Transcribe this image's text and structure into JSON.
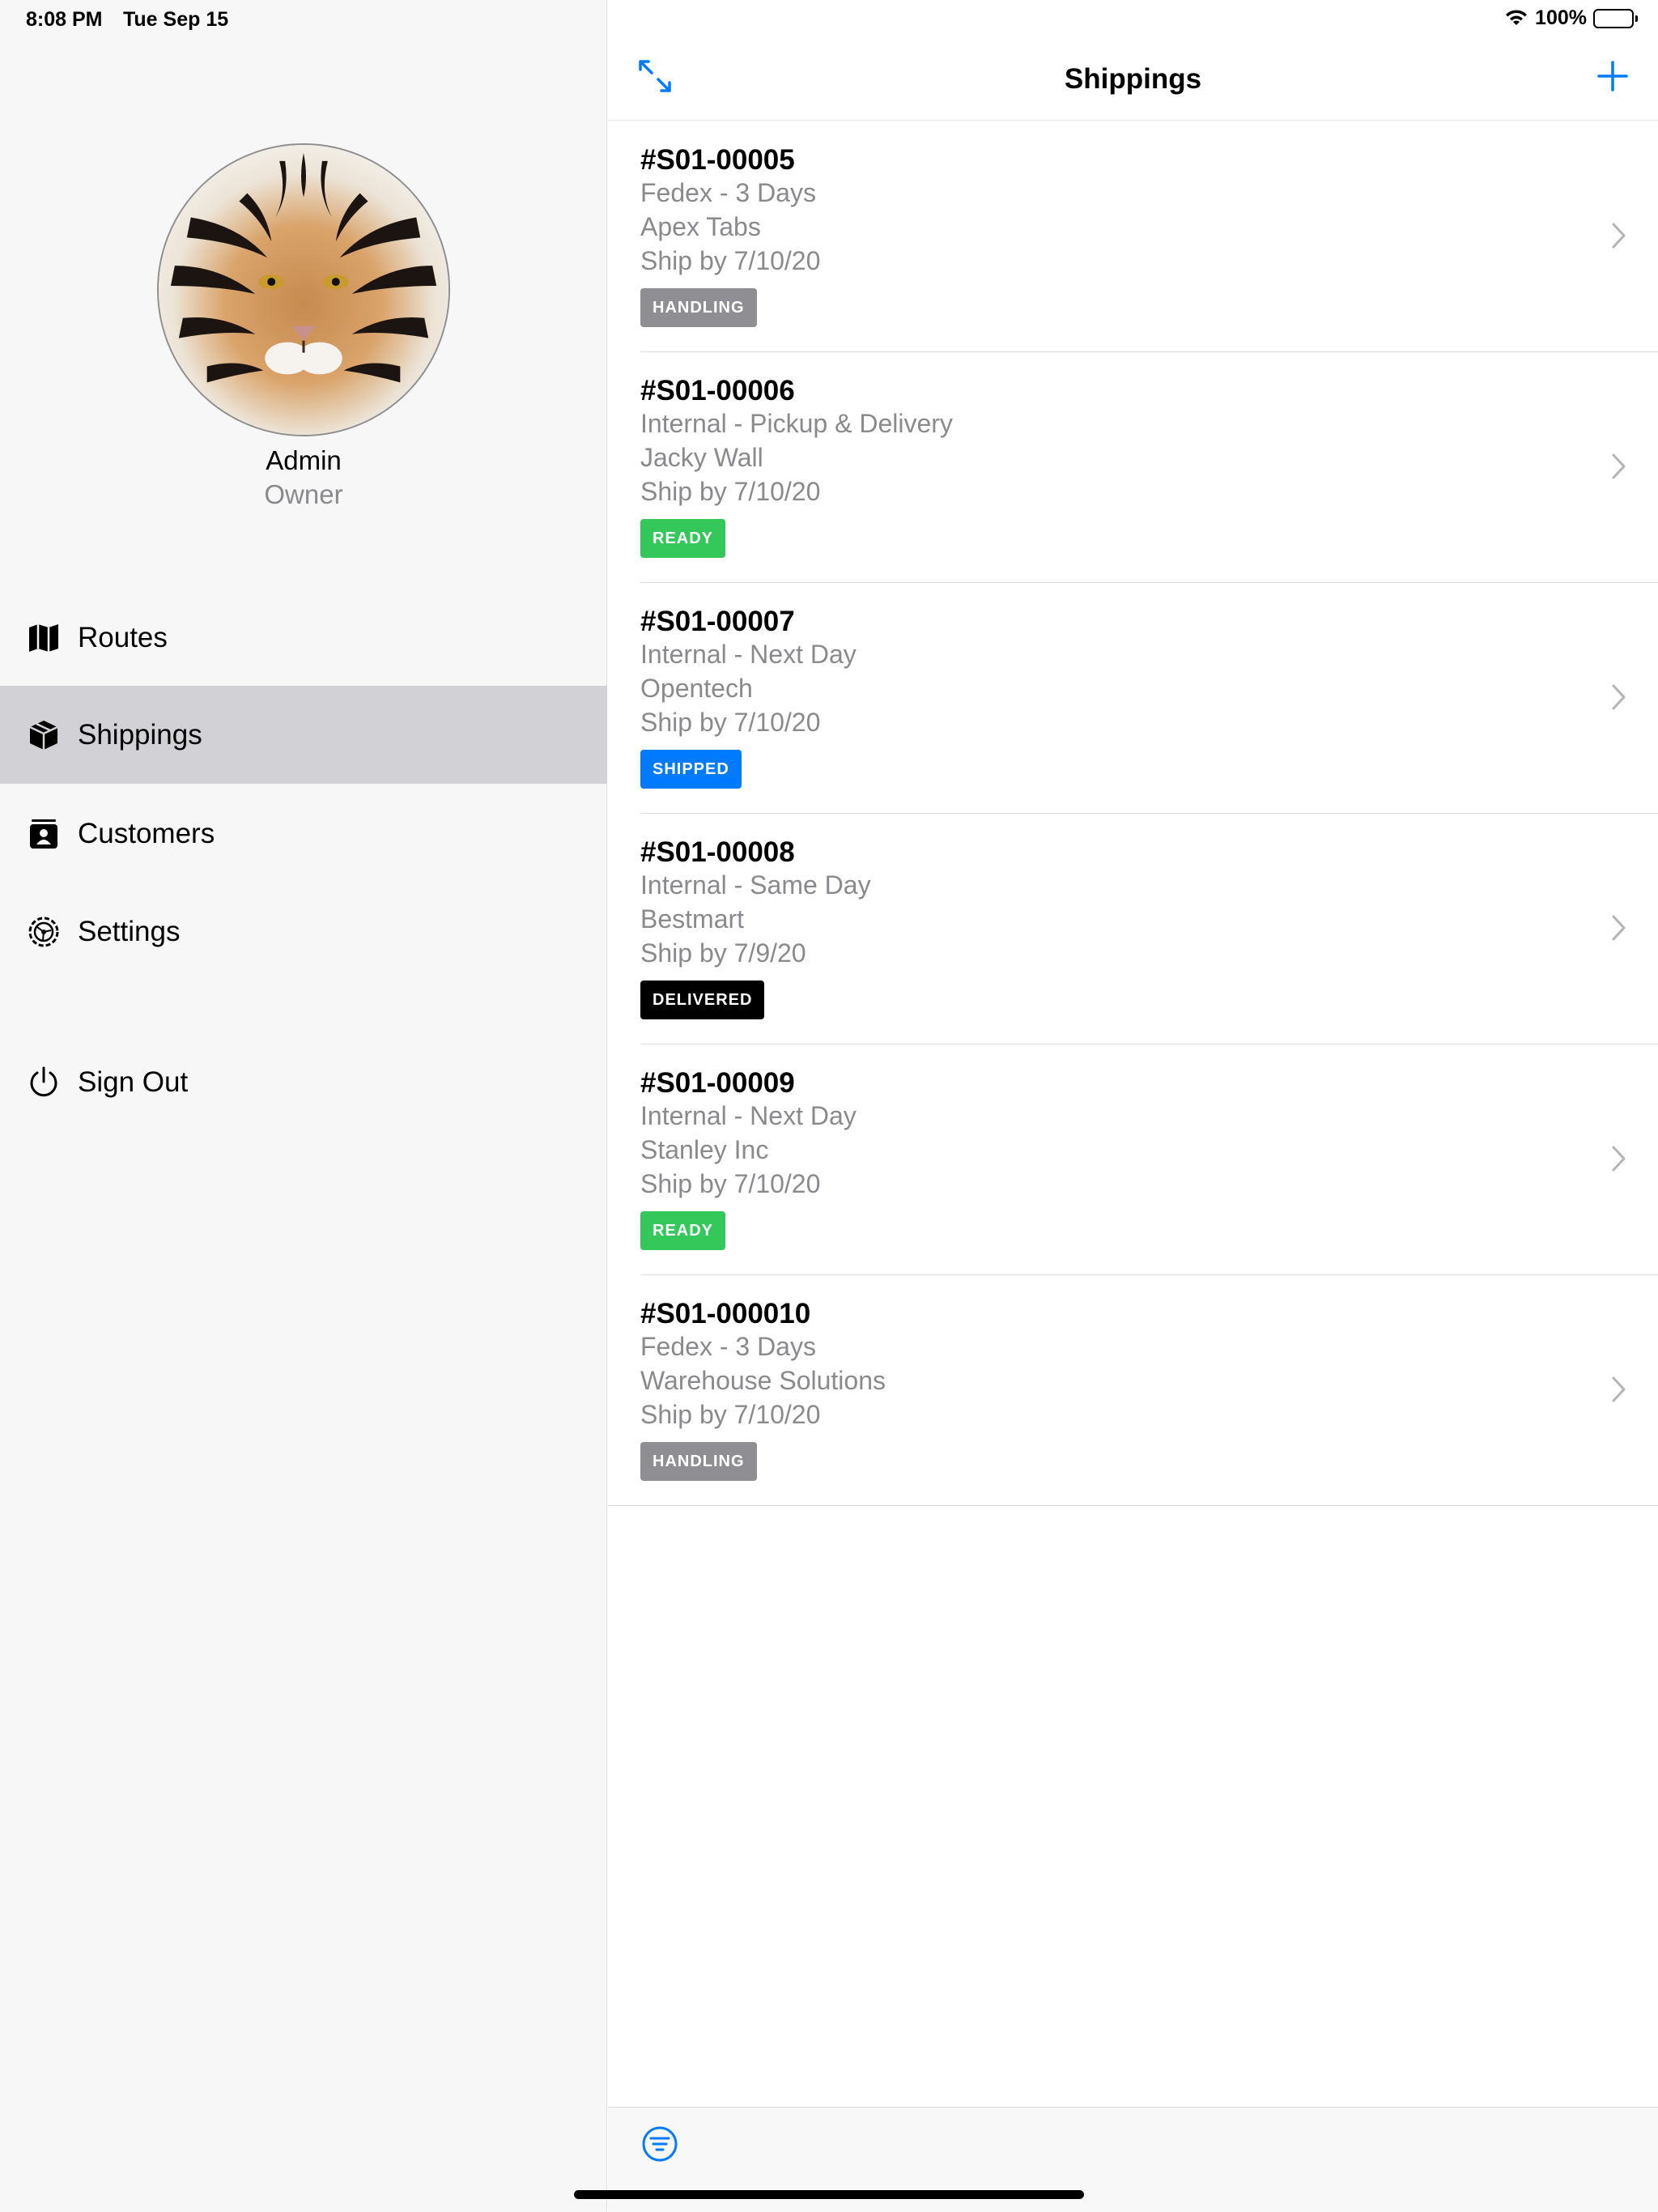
{
  "status_bar": {
    "time": "8:08 PM",
    "date": "Tue Sep 15",
    "battery": "100%",
    "icons": [
      "wifi-icon",
      "battery-icon"
    ]
  },
  "sidebar": {
    "profile": {
      "name": "Admin",
      "role": "Owner"
    },
    "items": [
      {
        "label": "Routes",
        "icon": "map-icon",
        "active": false
      },
      {
        "label": "Shippings",
        "icon": "box-icon",
        "active": true
      },
      {
        "label": "Customers",
        "icon": "contact-book-icon",
        "active": false
      },
      {
        "label": "Settings",
        "icon": "gear-icon",
        "active": false
      }
    ],
    "sign_out": {
      "label": "Sign Out",
      "icon": "power-icon"
    }
  },
  "navbar": {
    "title": "Shippings",
    "left_icon": "expand-icon",
    "right_icon": "plus-icon"
  },
  "colors": {
    "accent": "#007aff",
    "handling": "#8e8e93",
    "ready": "#34c759",
    "shipped": "#007aff",
    "delivered": "#000000",
    "sidebar_active": "#d1d1d6"
  },
  "shipments": [
    {
      "id": "#S01-00005",
      "service": "Fedex - 3 Days",
      "customer": "Apex Tabs",
      "ship_by": "Ship by 7/10/20",
      "status": "HANDLING",
      "status_color": "#8e8e93"
    },
    {
      "id": "#S01-00006",
      "service": "Internal - Pickup & Delivery",
      "customer": "Jacky Wall",
      "ship_by": "Ship by 7/10/20",
      "status": "READY",
      "status_color": "#34c759"
    },
    {
      "id": "#S01-00007",
      "service": "Internal - Next Day",
      "customer": "Opentech",
      "ship_by": "Ship by 7/10/20",
      "status": "SHIPPED",
      "status_color": "#007aff"
    },
    {
      "id": "#S01-00008",
      "service": "Internal - Same Day",
      "customer": "Bestmart",
      "ship_by": "Ship by 7/9/20",
      "status": "DELIVERED",
      "status_color": "#000000"
    },
    {
      "id": "#S01-00009",
      "service": "Internal - Next Day",
      "customer": "Stanley Inc",
      "ship_by": "Ship by 7/10/20",
      "status": "READY",
      "status_color": "#34c759"
    },
    {
      "id": "#S01-000010",
      "service": "Fedex - 3 Days",
      "customer": "Warehouse Solutions",
      "ship_by": "Ship by 7/10/20",
      "status": "HANDLING",
      "status_color": "#8e8e93"
    }
  ],
  "toolbar": {
    "icon": "filter-icon"
  }
}
